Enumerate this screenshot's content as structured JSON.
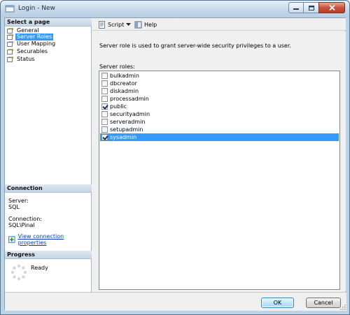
{
  "window": {
    "title": "Login - New"
  },
  "left": {
    "select_page_header": "Select a page",
    "pages": [
      {
        "label": "General",
        "icon": "page-icon",
        "selected": false
      },
      {
        "label": "Server Roles",
        "icon": "page-icon",
        "selected": true
      },
      {
        "label": "User Mapping",
        "icon": "page-icon",
        "selected": false
      },
      {
        "label": "Securables",
        "icon": "page-icon",
        "selected": false
      },
      {
        "label": "Status",
        "icon": "page-icon",
        "selected": false
      }
    ],
    "connection_header": "Connection",
    "server_label": "Server:",
    "server_value": "SQL",
    "connection_label": "Connection:",
    "connection_value": "SQL\\Pinal",
    "view_connection_link": "View connection properties",
    "progress_header": "Progress",
    "progress_status": "Ready"
  },
  "toolbar": {
    "script_label": "Script",
    "help_label": "Help"
  },
  "content": {
    "description": "Server role is used to grant server-wide security privileges to a user.",
    "roles_label": "Server roles:",
    "roles": [
      {
        "name": "bulkadmin",
        "checked": false,
        "selected": false
      },
      {
        "name": "dbcreator",
        "checked": false,
        "selected": false
      },
      {
        "name": "diskadmin",
        "checked": false,
        "selected": false
      },
      {
        "name": "processadmin",
        "checked": false,
        "selected": false
      },
      {
        "name": "public",
        "checked": true,
        "selected": false
      },
      {
        "name": "securityadmin",
        "checked": false,
        "selected": false
      },
      {
        "name": "serveradmin",
        "checked": false,
        "selected": false
      },
      {
        "name": "setupadmin",
        "checked": false,
        "selected": false
      },
      {
        "name": "sysadmin",
        "checked": true,
        "selected": true
      }
    ]
  },
  "footer": {
    "ok_label": "OK",
    "cancel_label": "Cancel"
  },
  "colors": {
    "selection": "#3399ff",
    "link": "#0c3cc7",
    "header_bg": "#c4d4e4"
  }
}
